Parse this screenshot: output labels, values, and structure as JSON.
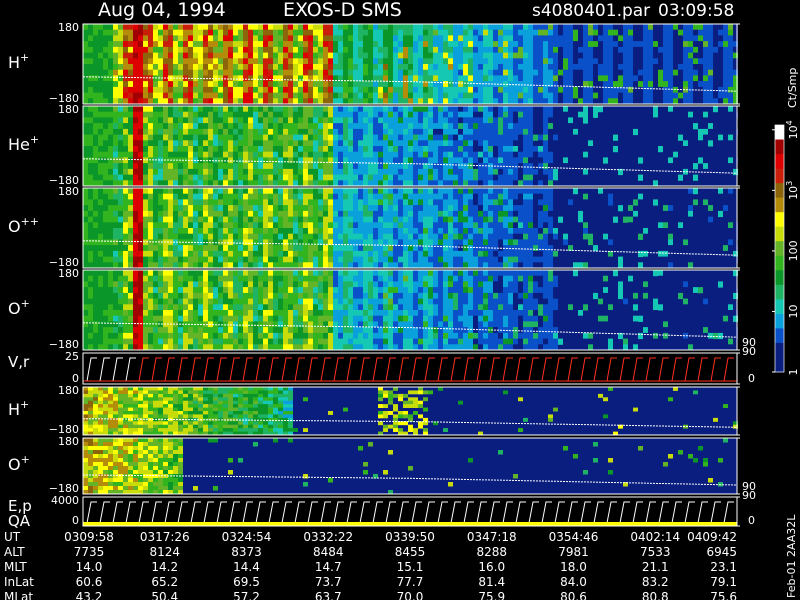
{
  "header": {
    "date": "Aug 04, 1994",
    "mission": "EXOS-D SMS",
    "file": "s4080401.par",
    "time": "03:09:58"
  },
  "colorbar": {
    "unit": "Ct/Smp",
    "ticks": [
      {
        "value": 1,
        "label": "1"
      },
      {
        "value": 10,
        "label": "10"
      },
      {
        "value": 100,
        "label": "100"
      },
      {
        "value": 1000,
        "label": "10",
        "exp": "3"
      },
      {
        "value": 10000,
        "label": "10",
        "exp": "4"
      }
    ],
    "min": 1,
    "max": 12000,
    "colors": [
      "#0a1e80",
      "#0a1e80",
      "#0a50c8",
      "#0aa0dc",
      "#14c8b4",
      "#1eb464",
      "#0a9628",
      "#32b41e",
      "#64b428",
      "#c8dc0a",
      "#ffff00",
      "#b48c0a",
      "#8c640a",
      "#c81e0a",
      "#dc0000",
      "#a00000",
      "#ffffff"
    ]
  },
  "chart_data": [
    {
      "type": "heatmap",
      "panel": "H+ angle",
      "species": "H",
      "charge": "+",
      "ylim": [
        -180,
        180
      ],
      "ytick_labels": [
        "180",
        "−180"
      ],
      "activity": 1.0
    },
    {
      "type": "heatmap",
      "panel": "He+ angle",
      "species": "He",
      "charge": "+",
      "ylim": [
        -180,
        180
      ],
      "ytick_labels": [
        "180",
        "−180"
      ],
      "activity": 0.55
    },
    {
      "type": "heatmap",
      "panel": "O++ angle",
      "species": "O",
      "charge": "++",
      "ylim": [
        -180,
        180
      ],
      "ytick_labels": [
        "180",
        "−180"
      ],
      "activity": 0.6
    },
    {
      "type": "heatmap",
      "panel": "O+ angle",
      "species": "O",
      "charge": "+",
      "ylim": [
        -180,
        180
      ],
      "ytick_labels": [
        "180",
        "−180"
      ],
      "activity": 0.6,
      "right_tick": "90"
    },
    {
      "type": "line",
      "panel": "V,r",
      "label": "V,r",
      "ylim": [
        0,
        25
      ],
      "ytick_labels": [
        "25",
        "0"
      ],
      "right_ticks": [
        "90",
        "0"
      ]
    },
    {
      "type": "heatmap",
      "panel": "H+ energy",
      "species": "H",
      "charge": "+",
      "ylim": [
        -180,
        180
      ],
      "ytick_labels": [
        "180",
        "−180"
      ],
      "activity": 0.5
    },
    {
      "type": "heatmap",
      "panel": "O+ energy",
      "species": "O",
      "charge": "+",
      "ylim": [
        -180,
        180
      ],
      "ytick_labels": [
        "180",
        "−180"
      ],
      "activity": 0.35,
      "right_tick": "90"
    },
    {
      "type": "line",
      "panel": "E,p QA",
      "label": "E,p",
      "label2": "QA",
      "ylim": [
        0,
        4000
      ],
      "ytick_labels": [
        "4000",
        "0"
      ],
      "right_ticks": [
        "90",
        "0"
      ]
    }
  ],
  "ephemeris": {
    "rows": [
      {
        "label": "UT",
        "values": [
          "0309:58",
          "0317:26",
          "0324:54",
          "0332:22",
          "0339:50",
          "0347:18",
          "0354:46",
          "0402:14",
          "0409:42"
        ]
      },
      {
        "label": "ALT",
        "values": [
          "7735",
          "8124",
          "8373",
          "8484",
          "8455",
          "8288",
          "7981",
          "7533",
          "6945"
        ]
      },
      {
        "label": "MLT",
        "values": [
          "14.0",
          "14.2",
          "14.4",
          "14.7",
          "15.1",
          "16.0",
          "18.0",
          "21.1",
          "23.1"
        ]
      },
      {
        "label": "InLat",
        "values": [
          "60.6",
          "65.2",
          "69.5",
          "73.7",
          "77.7",
          "81.4",
          "84.0",
          "83.2",
          "79.1"
        ]
      },
      {
        "label": "MLat",
        "values": [
          "43.2",
          "50.4",
          "57.2",
          "63.7",
          "70.0",
          "75.9",
          "80.6",
          "80.8",
          "75.6"
        ]
      }
    ]
  },
  "footer": {
    "version": "Feb-01 2AA32L"
  }
}
